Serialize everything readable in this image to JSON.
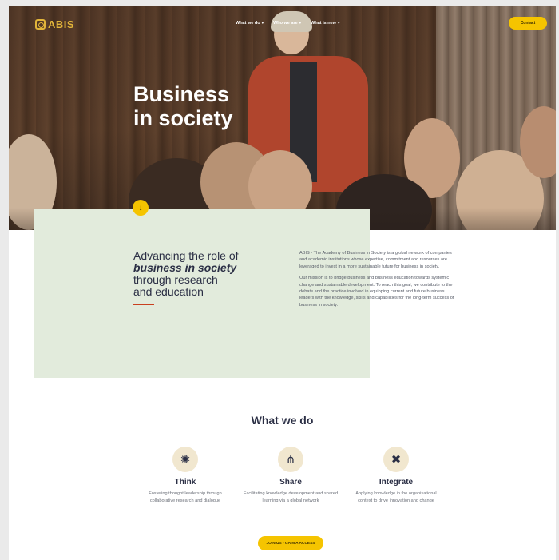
{
  "header": {
    "logo_text": "ABIS",
    "nav": [
      {
        "label": "What we do",
        "caret": "▾"
      },
      {
        "label": "Who we are",
        "caret": "▾"
      },
      {
        "label": "What is new",
        "caret": "▾"
      }
    ],
    "contact_label": "Contact"
  },
  "hero": {
    "title_line1": "Business",
    "title_line2": "in society",
    "scroll_icon": "↓"
  },
  "intro": {
    "tagline_line1": "Advancing the role of",
    "tagline_emphasis": "business in society",
    "tagline_line3": "through research",
    "tagline_line4": "and education",
    "paragraph1": "ABIS - The Academy of Business in Society is a global network of companies and academic institutions whose expertise, commitment and resources are leveraged to invest in a more sustainable future for business in society.",
    "paragraph2": "Our mission is to bridge business and business education towards systemic change and sustainable development. To reach this goal, we contribute to the debate and the practice involved in equipping current and future business leaders with the knowledge, skills and capabilities for the long-term success of business in society."
  },
  "what_we_do": {
    "title": "What we do",
    "features": [
      {
        "icon": "lightbulb-icon",
        "glyph": "✺",
        "title": "Think",
        "description": "Fostering thought leadership through collaborative research and dialogue"
      },
      {
        "icon": "network-icon",
        "glyph": "⋔",
        "title": "Share",
        "description": "Facilitating knowledge development and shared learning via a global network"
      },
      {
        "icon": "tools-icon",
        "glyph": "✖",
        "title": "Integrate",
        "description": "Applying knowledge in the organisational context to drive innovation and change"
      }
    ],
    "cta_label": "JOIN US - GAIN A ACCESS"
  },
  "colors": {
    "accent": "#f5c400",
    "logo": "#e2b53a",
    "navy": "#2b2f45",
    "panel": "#e2ebdc",
    "rule": "#c9401f"
  }
}
